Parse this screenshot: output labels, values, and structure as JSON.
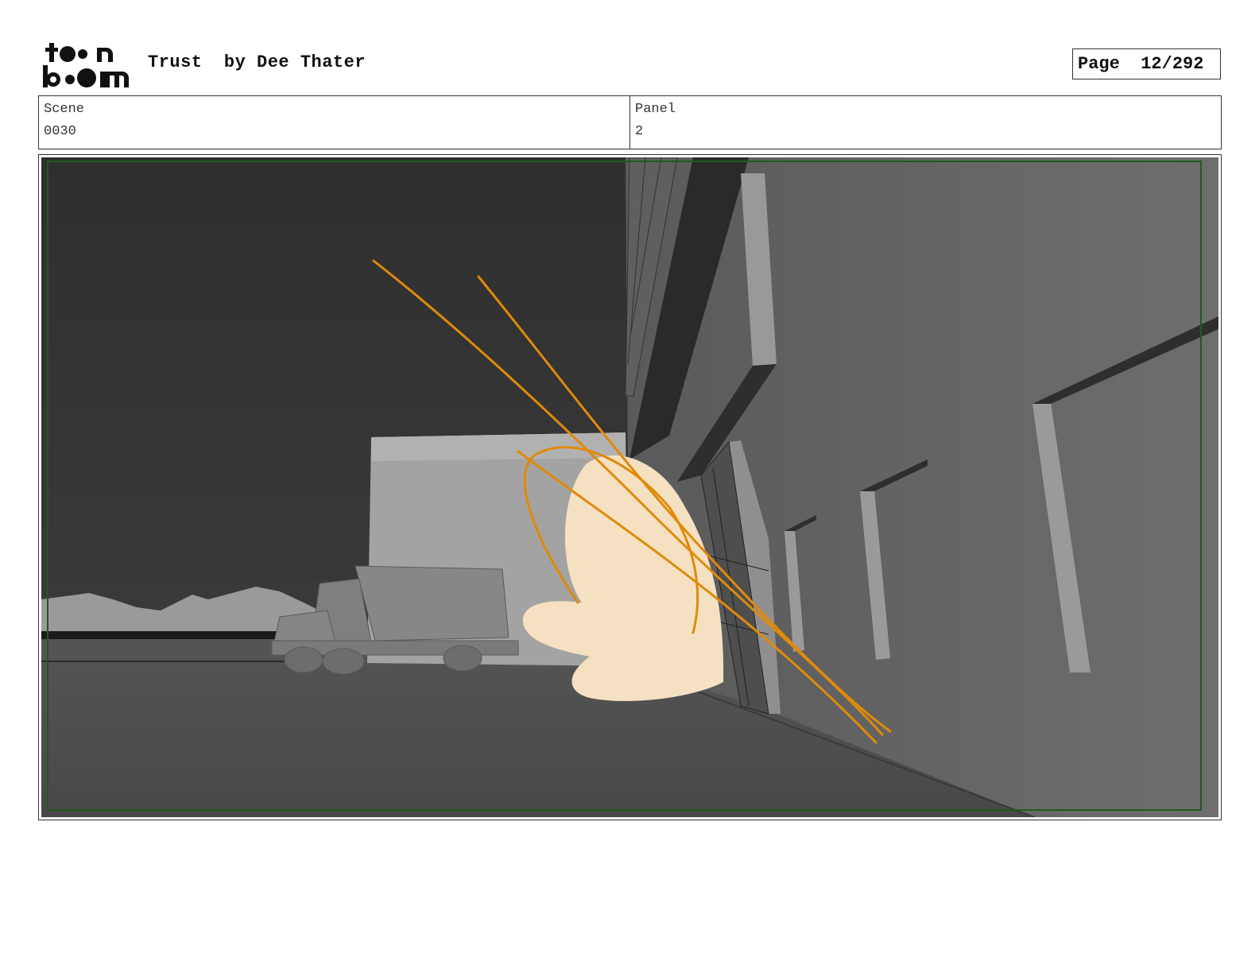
{
  "header": {
    "logo_text_top": "toon",
    "logo_text_bottom": "boom",
    "title": "Trust  by Dee Thater",
    "page_label": "Page  12/292"
  },
  "info": {
    "scene_label": "Scene",
    "scene_value": "0030",
    "panel_label": "Panel",
    "panel_value": "2"
  },
  "panel": {
    "safe_frame_color": "#1f5a1f",
    "sketch_color": "#e08a0a",
    "hand_color": "#f5e1c1"
  }
}
